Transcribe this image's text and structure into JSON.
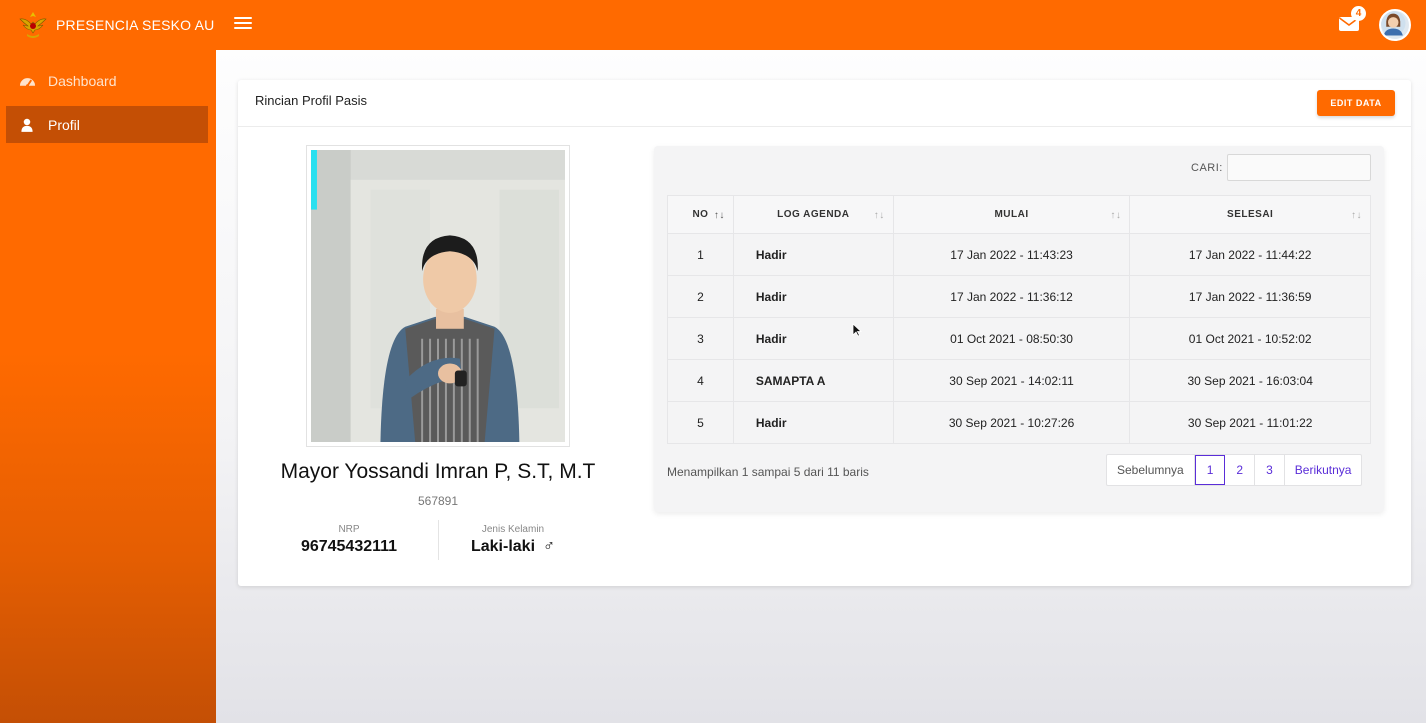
{
  "brand": {
    "name": "PRESENCIA SESKO AU",
    "logo_icon": "eagle-emblem-icon"
  },
  "header": {
    "mail_count": "4",
    "accent": "#ff6a00"
  },
  "sidebar": {
    "items": [
      {
        "label": "Dashboard",
        "icon": "dashboard-icon"
      },
      {
        "label": "Profil",
        "icon": "user-icon",
        "active": true
      }
    ]
  },
  "card": {
    "title": "Rincian Profil Pasis",
    "edit_label": "EDIT DATA"
  },
  "profile": {
    "name": "Mayor Yossandi Imran P, S.T, M.T",
    "id": "567891",
    "nrp_label": "NRP",
    "nrp_value": "96745432111",
    "gender_label": "Jenis Kelamin",
    "gender_value": "Laki-laki",
    "gender_symbol": "♂"
  },
  "table": {
    "search_label": "CARI:",
    "search_value": "",
    "columns": [
      "NO",
      "LOG AGENDA",
      "MULAI",
      "SELESAI"
    ],
    "rows": [
      [
        "1",
        "Hadir",
        "17 Jan 2022 - 11:43:23",
        "17 Jan 2022 - 11:44:22"
      ],
      [
        "2",
        "Hadir",
        "17 Jan 2022 - 11:36:12",
        "17 Jan 2022 - 11:36:59"
      ],
      [
        "3",
        "Hadir",
        "01 Oct 2021 - 08:50:30",
        "01 Oct 2021 - 10:52:02"
      ],
      [
        "4",
        "SAMAPTA A",
        "30 Sep 2021 - 14:02:11",
        "30 Sep 2021 - 16:03:04"
      ],
      [
        "5",
        "Hadir",
        "30 Sep 2021 - 10:27:26",
        "30 Sep 2021 - 11:01:22"
      ]
    ],
    "info": "Menampilkan 1 sampai 5 dari 11 baris",
    "pagination": {
      "prev": "Sebelumnya",
      "pages": [
        "1",
        "2",
        "3"
      ],
      "current": "1",
      "next": "Berikutnya"
    }
  }
}
